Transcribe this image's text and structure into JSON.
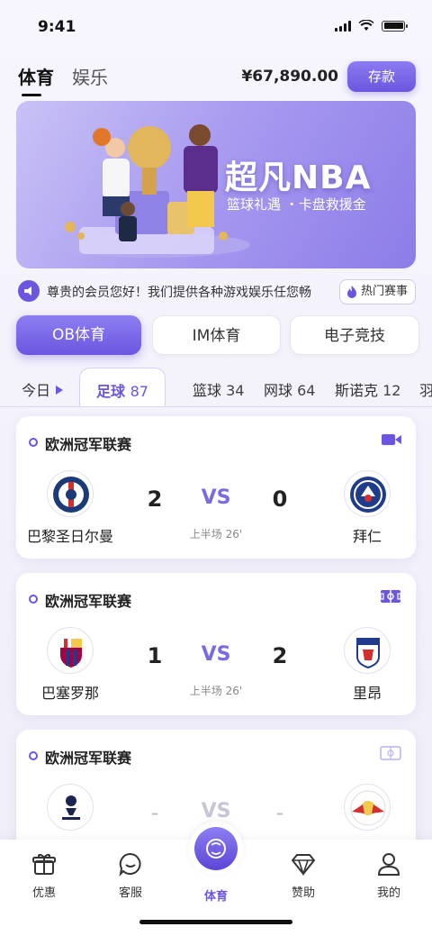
{
  "status": {
    "time": "9:41"
  },
  "header": {
    "tabs": [
      {
        "label": "体育",
        "active": true
      },
      {
        "label": "娱乐",
        "active": false
      }
    ],
    "balance": "¥67,890.00",
    "deposit_label": "存款"
  },
  "banner": {
    "title": "超凡NBA",
    "subtitle": "篮球礼遇 ・卡盘救援金"
  },
  "notice": {
    "text": "尊贵的会员您好！我们提供各种游戏娱乐任您畅",
    "hot_label": "热门赛事"
  },
  "venues": [
    {
      "label": "OB体育",
      "active": true
    },
    {
      "label": "IM体育",
      "active": false
    },
    {
      "label": "电子竞技",
      "active": false
    }
  ],
  "sport_tabs": [
    {
      "label": "今日",
      "count": ""
    },
    {
      "label": "足球",
      "count": "87",
      "active": true
    },
    {
      "label": "篮球",
      "count": "34"
    },
    {
      "label": "网球",
      "count": "64"
    },
    {
      "label": "斯诺克",
      "count": "12"
    },
    {
      "label": "羽",
      "count": ""
    }
  ],
  "matches": [
    {
      "league": "欧洲冠军联赛",
      "home": "巴黎圣日尔曼",
      "away": "拜仁",
      "home_score": "2",
      "away_score": "0",
      "vs": "VS",
      "period": "上半场 26'",
      "icon": "live-video-icon"
    },
    {
      "league": "欧洲冠军联赛",
      "home": "巴塞罗那",
      "away": "里昂",
      "home_score": "1",
      "away_score": "2",
      "vs": "VS",
      "period": "上半场 26'",
      "icon": "pitch-icon"
    },
    {
      "league": "欧洲冠军联赛",
      "home": "",
      "away": "",
      "home_score": "-",
      "away_score": "-",
      "vs": "VS",
      "period": "",
      "icon": "pitch-icon"
    }
  ],
  "bottom_nav": [
    {
      "label": "优惠",
      "icon": "gift-icon"
    },
    {
      "label": "客服",
      "icon": "chat-icon"
    },
    {
      "label": "体育",
      "icon": "sports-ball-icon",
      "active": true
    },
    {
      "label": "赞助",
      "icon": "diamond-icon"
    },
    {
      "label": "我的",
      "icon": "user-icon"
    }
  ],
  "colors": {
    "accent": "#6a56e0",
    "banner": "#a99cf0",
    "text": "#222222"
  }
}
